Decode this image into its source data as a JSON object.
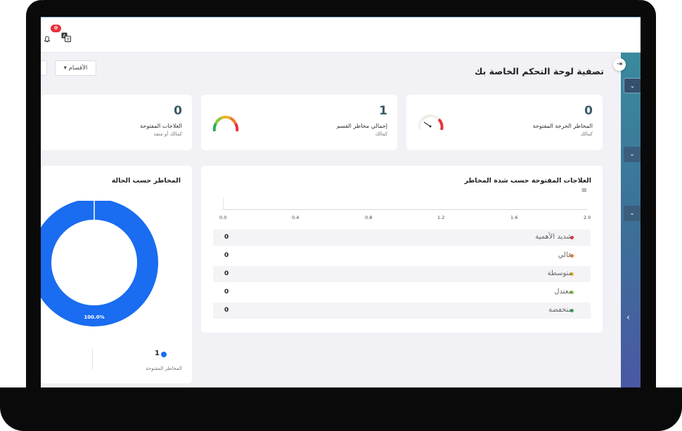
{
  "topbar": {
    "notification_count": "0"
  },
  "header": {
    "title": "تصفية لوحة التحكم الخاصة بك",
    "departments_label": "الأقسام ▾"
  },
  "sidebar": {
    "toggles": [
      "⌄",
      "⌄",
      "⌄"
    ],
    "collapse_arrow": "‹",
    "collapse_icon": "⇥"
  },
  "kpis": [
    {
      "value": "0",
      "label": "المخاطر الحرجة المفتوحة",
      "sub": "كمالك"
    },
    {
      "value": "1",
      "label": "إجمالي مخاطر القسم",
      "sub": "كمالك"
    },
    {
      "value": "0",
      "label": "العلاجات المفتوحة",
      "sub": "كمالك أو منفذ"
    }
  ],
  "severity_panel": {
    "title": "العلاجات المفتوحة حسب شدة المخاطر",
    "menu_icon": "≡",
    "chart_data": {
      "type": "bar",
      "categories": [
        "شديد الأهمية",
        "عالي",
        "متوسطة",
        "معتدل",
        "منخفضة"
      ],
      "values": [
        0,
        0,
        0,
        0,
        0
      ],
      "xlim": [
        0,
        2
      ],
      "xticks": [
        "0.0",
        "0.4",
        "0.8",
        "1.2",
        "1.6",
        "2.0"
      ]
    },
    "rows": [
      {
        "label": "شديد الأهمية",
        "count": "0",
        "color": "#e8313b"
      },
      {
        "label": "عالي",
        "count": "0",
        "color": "#f07b2a"
      },
      {
        "label": "متوسطة",
        "count": "0",
        "color": "#e8b52a"
      },
      {
        "label": "معتدل",
        "count": "0",
        "color": "#8cc63e"
      },
      {
        "label": "منخفضة",
        "count": "0",
        "color": "#27ae60"
      }
    ]
  },
  "status_panel": {
    "title": "المخاطر حسب الحالة",
    "chart_data": {
      "type": "pie",
      "labels": [
        "المخاطر المفتوحة"
      ],
      "values": [
        1
      ],
      "percent_labels": [
        "100.0%"
      ],
      "colors": [
        "#1a6cf0"
      ]
    },
    "legend": {
      "value": "1",
      "label": "المخاطر المفتوحة",
      "color": "#1a6cf0"
    }
  }
}
